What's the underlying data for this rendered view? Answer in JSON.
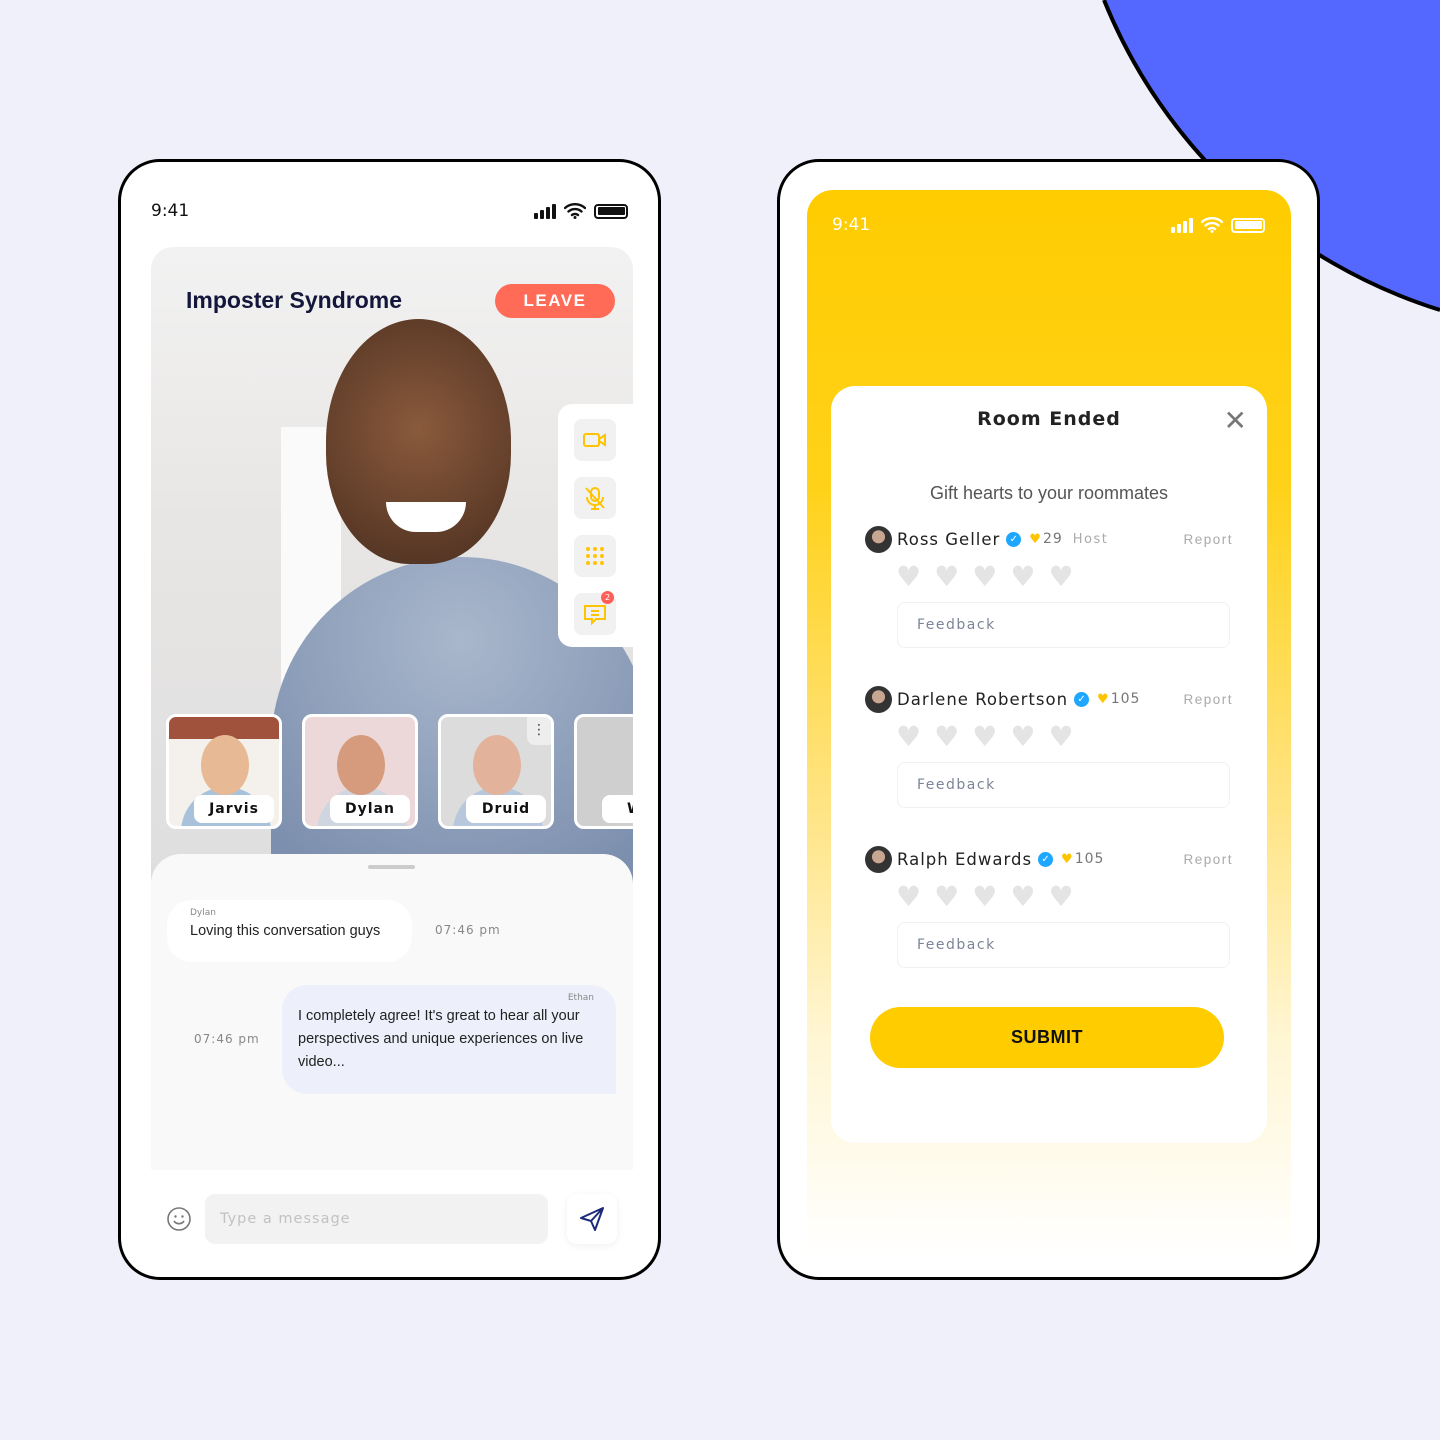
{
  "colors": {
    "background": "#EFF0FA",
    "accent_blue": "#5468FF",
    "leave": "#FF6B57",
    "yellow": "#FFCC00",
    "verified": "#1FA7FF"
  },
  "call_screen": {
    "status_time": "9:41",
    "room_title": "Imposter Syndrome",
    "leave_label": "LEAVE",
    "controls": [
      {
        "icon": "video-camera-icon"
      },
      {
        "icon": "mic-off-icon"
      },
      {
        "icon": "grid-icon"
      },
      {
        "icon": "chat-icon",
        "badge": "2"
      }
    ],
    "participants": [
      {
        "name": "Jarvis"
      },
      {
        "name": "Dylan"
      },
      {
        "name": "Druid"
      },
      {
        "name": "W"
      }
    ],
    "messages": [
      {
        "sender": "Dylan",
        "text": "Loving this conversation guys",
        "time": "07:46 pm"
      },
      {
        "sender": "Ethan",
        "text": "I completely agree! It's great to hear all your perspectives and unique experiences on live video...",
        "time": "07:46 pm"
      }
    ],
    "message_placeholder": "Type a message"
  },
  "ended_screen": {
    "status_time": "9:41",
    "title": "Room Ended",
    "subtitle": "Gift hearts to your roommates",
    "roommates": [
      {
        "name": "Ross Geller",
        "hearts": "29",
        "role": "Host",
        "report": "Report",
        "feedback_placeholder": "Feedback",
        "rating": 0
      },
      {
        "name": "Darlene Robertson",
        "hearts": "105",
        "role": "",
        "report": "Report",
        "feedback_placeholder": "Feedback",
        "rating": 0
      },
      {
        "name": "Ralph Edwards",
        "hearts": "105",
        "role": "",
        "report": "Report",
        "feedback_placeholder": "Feedback",
        "rating": 0
      }
    ],
    "submit_label": "SUBMIT"
  }
}
